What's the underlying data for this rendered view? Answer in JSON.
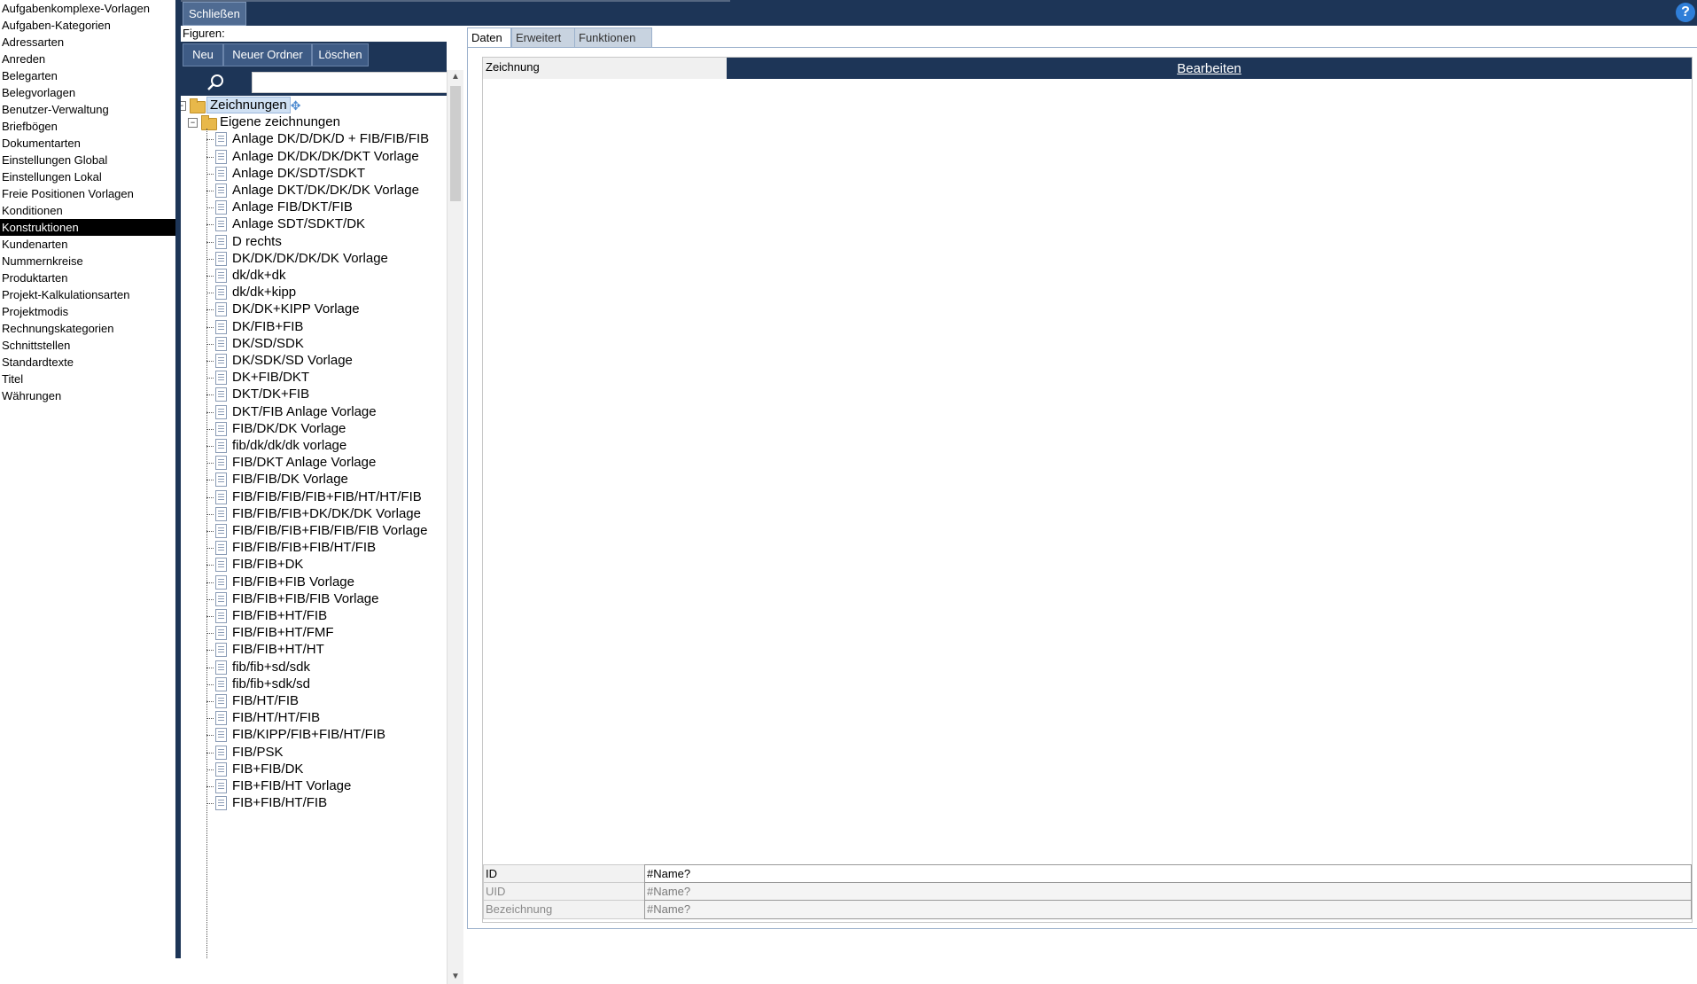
{
  "nav": {
    "items": [
      "Aufgabenkomplexe-Vorlagen",
      "Aufgaben-Kategorien",
      "Adressarten",
      "Anreden",
      "Belegarten",
      "Belegvorlagen",
      "Benutzer-Verwaltung",
      "Briefbögen",
      "Dokumentarten",
      "Einstellungen Global",
      "Einstellungen Lokal",
      "Freie Positionen Vorlagen",
      "Konditionen",
      "Konstruktionen",
      "Kundenarten",
      "Nummernkreise",
      "Produktarten",
      "Projekt-Kalkulationsarten",
      "Projektmodis",
      "Rechnungskategorien",
      "Schnittstellen",
      "Standardtexte",
      "Titel",
      "Währungen"
    ],
    "selected": "Konstruktionen"
  },
  "topbar": {
    "close_label": "Schließen",
    "help_label": "?"
  },
  "figures": {
    "label": "Figuren:",
    "toolbar": {
      "new_label": "Neu",
      "new_folder_label": "Neuer Ordner",
      "delete_label": "Löschen"
    },
    "search": {
      "value": "",
      "placeholder": ""
    },
    "root": "Zeichnungen",
    "folder": "Eigene zeichnungen",
    "items": [
      "Anlage DK/D/DK/D + FIB/FIB/FIB",
      "Anlage DK/DK/DK/DKT Vorlage",
      "Anlage DK/SDT/SDKT",
      "Anlage DKT/DK/DK/DK Vorlage",
      "Anlage FIB/DKT/FIB",
      "Anlage SDT/SDKT/DK",
      "D rechts",
      "DK/DK/DK/DK/DK Vorlage",
      "dk/dk+dk",
      "dk/dk+kipp",
      "DK/DK+KIPP Vorlage",
      "DK/FIB+FIB",
      "DK/SD/SDK",
      "DK/SDK/SD Vorlage",
      "DK+FIB/DKT",
      "DKT/DK+FIB",
      "DKT/FIB Anlage Vorlage",
      "FIB/DK/DK Vorlage",
      "fib/dk/dk/dk vorlage",
      "FIB/DKT Anlage Vorlage",
      "FIB/FIB/DK Vorlage",
      "FIB/FIB/FIB/FIB+FIB/HT/HT/FIB",
      "FIB/FIB/FIB+DK/DK/DK Vorlage",
      "FIB/FIB/FIB+FIB/FIB/FIB Vorlage",
      "FIB/FIB/FIB+FIB/HT/FIB",
      "FIB/FIB+DK",
      "FIB/FIB+FIB Vorlage",
      "FIB/FIB+FIB/FIB Vorlage",
      "FIB/FIB+HT/FIB",
      "FIB/FIB+HT/FMF",
      "FIB/FIB+HT/HT",
      "fib/fib+sd/sdk",
      "fib/fib+sdk/sd",
      "FIB/HT/FIB",
      "FIB/HT/HT/FIB",
      "FIB/KIPP/FIB+FIB/HT/FIB",
      "FIB/PSK",
      "FIB+FIB/DK",
      "FIB+FIB/HT Vorlage",
      "FIB+FIB/HT/FIB"
    ]
  },
  "tabs": [
    "Daten",
    "Erweitert",
    "Funktionen"
  ],
  "detail": {
    "drawing_label": "Zeichnung",
    "edit_label": "Bearbeiten",
    "fields": [
      {
        "label": "ID",
        "value": "#Name?"
      },
      {
        "label": "UID",
        "value": "#Name?"
      },
      {
        "label": "Bezeichnung",
        "value": "#Name?"
      }
    ]
  },
  "colors": {
    "accent": "#1d3557",
    "selected_bg": "#000000",
    "help": "#2f7ed8"
  }
}
